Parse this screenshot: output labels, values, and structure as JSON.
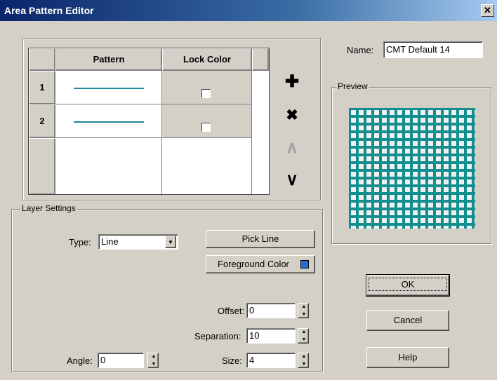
{
  "window": {
    "title": "Area Pattern Editor",
    "close_glyph": "✕"
  },
  "name_field": {
    "label": "Name:",
    "value": "CMT Default 14"
  },
  "preview": {
    "label": "Preview",
    "pattern_color": "#118e8e",
    "background": "#d4d0c8"
  },
  "grid": {
    "headers": [
      "Pattern",
      "Lock Color"
    ],
    "rows": [
      {
        "number": "1",
        "line_color": "#1c8a9c",
        "lock_color": false
      },
      {
        "number": "2",
        "line_color": "#1c8a9c",
        "lock_color": false
      }
    ]
  },
  "side_buttons": {
    "add": {
      "icon": "plus-icon",
      "glyph": "✚"
    },
    "delete": {
      "icon": "x-icon",
      "glyph": "✖"
    },
    "up": {
      "icon": "chevron-up-icon",
      "glyph": "∧"
    },
    "down": {
      "icon": "chevron-down-icon",
      "glyph": "∨"
    }
  },
  "layer_settings": {
    "label": "Layer Settings",
    "type_label": "Type:",
    "type_value": "Line",
    "pick_line_label": "Pick Line",
    "foreground_color_label": "Foreground Color",
    "foreground_color": "#1e6fd8",
    "offset_label": "Offset:",
    "offset_value": "0",
    "separation_label": "Separation:",
    "separation_value": "10",
    "size_label": "Size:",
    "size_value": "4",
    "angle_label": "Angle:",
    "angle_value": "0"
  },
  "buttons": {
    "ok": "OK",
    "cancel": "Cancel",
    "help": "Help"
  }
}
